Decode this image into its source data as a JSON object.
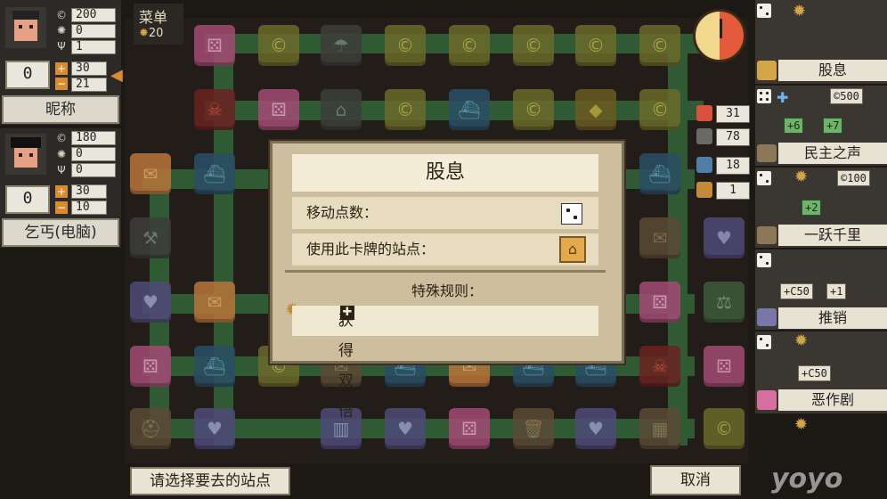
{
  "menu": {
    "label": "菜单",
    "count": "20"
  },
  "players": [
    {
      "money": "200",
      "s2": "0",
      "s3": "1",
      "turn_value": "0",
      "plus": "30",
      "minus": "21",
      "name": "昵称"
    },
    {
      "money": "180",
      "s2": "0",
      "s3": "0",
      "turn_value": "0",
      "plus": "30",
      "minus": "10",
      "name": "乞丐(电脑)"
    }
  ],
  "stats": [
    "31",
    "78",
    "18",
    "1"
  ],
  "cards": [
    {
      "name": "股息"
    },
    {
      "cost": "500",
      "effect_a": "+6",
      "effect_b": "+7",
      "name": "民主之声"
    },
    {
      "cost": "100",
      "effect_a": "+2",
      "name": "一跃千里"
    },
    {
      "effect_a": "+C50",
      "effect_b": "+1",
      "name": "推销"
    },
    {
      "effect_a": "+C50",
      "name": "恶作剧"
    }
  ],
  "modal": {
    "title": "股息",
    "move_label": "移动点数：",
    "station_label": "使用此卡牌的站点：",
    "special_heading": "特殊规则：",
    "special_text": "获得双倍",
    "special_suffix": "。"
  },
  "bottom": {
    "hint": "请选择要去的站点",
    "cancel": "取消"
  },
  "watermark": "yoyo"
}
